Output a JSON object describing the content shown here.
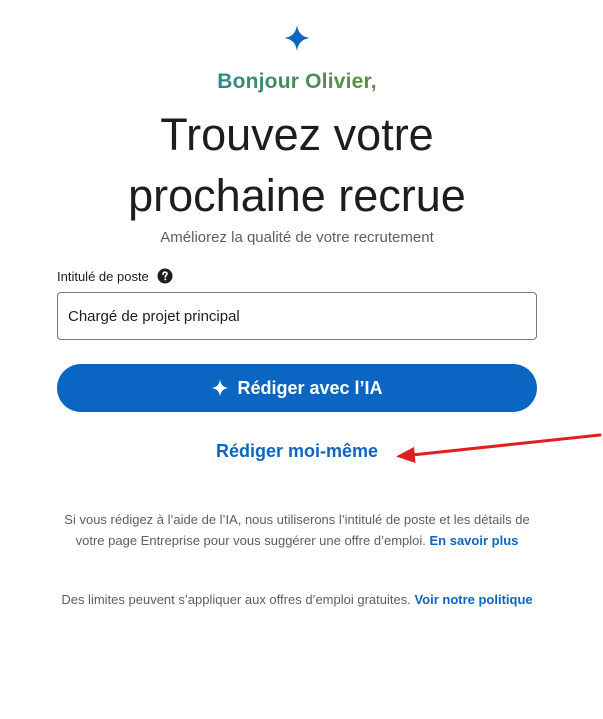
{
  "header": {
    "greeting": "Bonjour Olivier,",
    "headline_line1": "Trouvez votre",
    "headline_line2": "prochaine recrue",
    "subtitle": "Améliorez la qualité de votre recrutement"
  },
  "form": {
    "job_title_label": "Intitulé de poste",
    "job_title_value": "Chargé de projet principal",
    "ai_button_label": "Rédiger avec l’IA",
    "self_write_label": "Rédiger moi-même"
  },
  "footer": {
    "info_text": "Si vous rédigez à l’aide de l’IA, nous utiliserons l’intitulé de poste et les détails de votre page Entreprise pour vous suggérer une offre d’emploi.",
    "info_link": "En savoir plus",
    "limit_text": "Des limites peuvent s’appliquer aux offres d’emploi gratuites.",
    "limit_link": "Voir notre politique"
  },
  "colors": {
    "accent": "#0a66c2",
    "annotation_arrow": "#e02020"
  },
  "icons": {
    "logo": "sparkle-icon",
    "help": "help-circle-icon",
    "button": "sparkle-icon",
    "annotation": "red-arrow-icon"
  }
}
